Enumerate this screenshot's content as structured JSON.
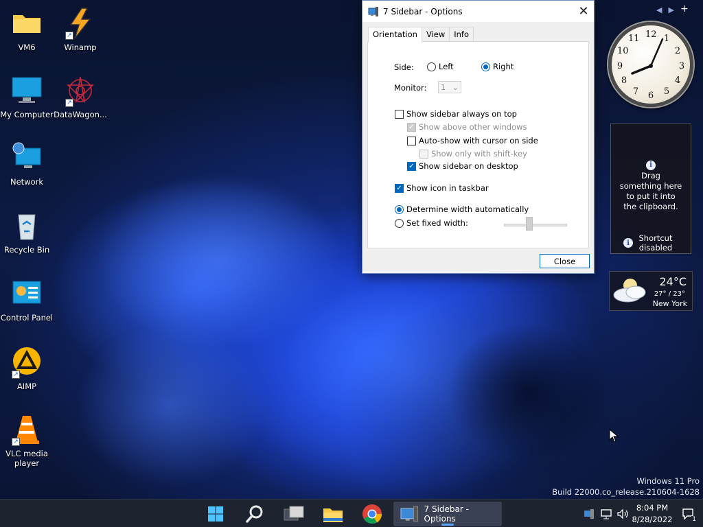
{
  "desktop": {
    "icons": [
      {
        "label": "VM6"
      },
      {
        "label": "Winamp"
      },
      {
        "label": "My Computer"
      },
      {
        "label": "DataWagon..."
      },
      {
        "label": "Network"
      },
      {
        "label": "Recycle Bin"
      },
      {
        "label": "Control Panel"
      },
      {
        "label": "AIMP"
      },
      {
        "label": "VLC media player"
      }
    ]
  },
  "dialog": {
    "title": "7 Sidebar - Options",
    "tabs": [
      {
        "label": "Orientation"
      },
      {
        "label": "View"
      },
      {
        "label": "Info"
      }
    ],
    "side_label": "Side:",
    "side_left": "Left",
    "side_right": "Right",
    "monitor_label": "Monitor:",
    "monitor_value": "1",
    "always_on_top": "Show sidebar always on top",
    "above_other": "Show above other windows",
    "auto_show": "Auto-show with cursor on side",
    "shift_key": "Show only with shift-key",
    "on_desktop": "Show sidebar on desktop",
    "taskbar_icon": "Show icon in taskbar",
    "width_auto": "Determine width automatically",
    "width_fixed": "Set fixed width:",
    "close_label": "Close"
  },
  "clock_gadget": {
    "numbers": [
      "12",
      "1",
      "2",
      "3",
      "4",
      "5",
      "6",
      "7",
      "8",
      "9",
      "10",
      "11"
    ]
  },
  "clipboard_gadget": {
    "message": "Drag something here to put it into the clipboard.",
    "shortcut": "Shortcut disabled"
  },
  "weather_gadget": {
    "temp": "24°C",
    "range": "27° / 23°",
    "city": "New York"
  },
  "watermark": {
    "line1": "Windows 11 Pro",
    "line2": "Build 22000.co_release.210604-1628"
  },
  "taskbar": {
    "task_label": "7 Sidebar - Options",
    "time": "8:04 PM",
    "date": "8/28/2022",
    "notification_count": "1"
  },
  "colors": {
    "accent": "#0067c0",
    "taskbar": "#1e2330"
  }
}
